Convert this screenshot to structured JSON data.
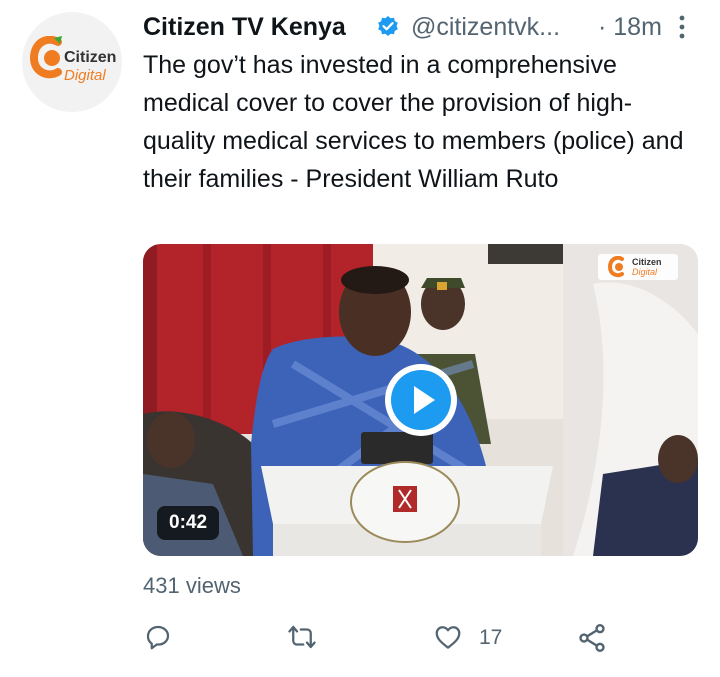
{
  "tweet": {
    "avatar": {
      "line1": "Citizen",
      "line2": "Digital"
    },
    "author": {
      "name": "Citizen TV Kenya",
      "handle": "@citizentvk...",
      "verified": true
    },
    "time": "· 18m",
    "text": "The gov’t has invested in a comprehensive medical cover to cover the provision of high-quality medical services to members (police) and their families - President William Ruto",
    "media": {
      "type": "video",
      "duration": "0:42",
      "watermark": {
        "line1": "Citizen",
        "line2": "Digital"
      }
    },
    "views": "431 views",
    "actions": {
      "reply": {
        "icon": "reply-icon",
        "count": ""
      },
      "retweet": {
        "icon": "retweet-icon",
        "count": ""
      },
      "like": {
        "icon": "heart-icon",
        "count": "17"
      },
      "share": {
        "icon": "share-icon",
        "count": ""
      }
    }
  },
  "colors": {
    "accent": "#1d9bf0",
    "secondary_text": "#536471",
    "brand_orange": "#f07c22"
  }
}
